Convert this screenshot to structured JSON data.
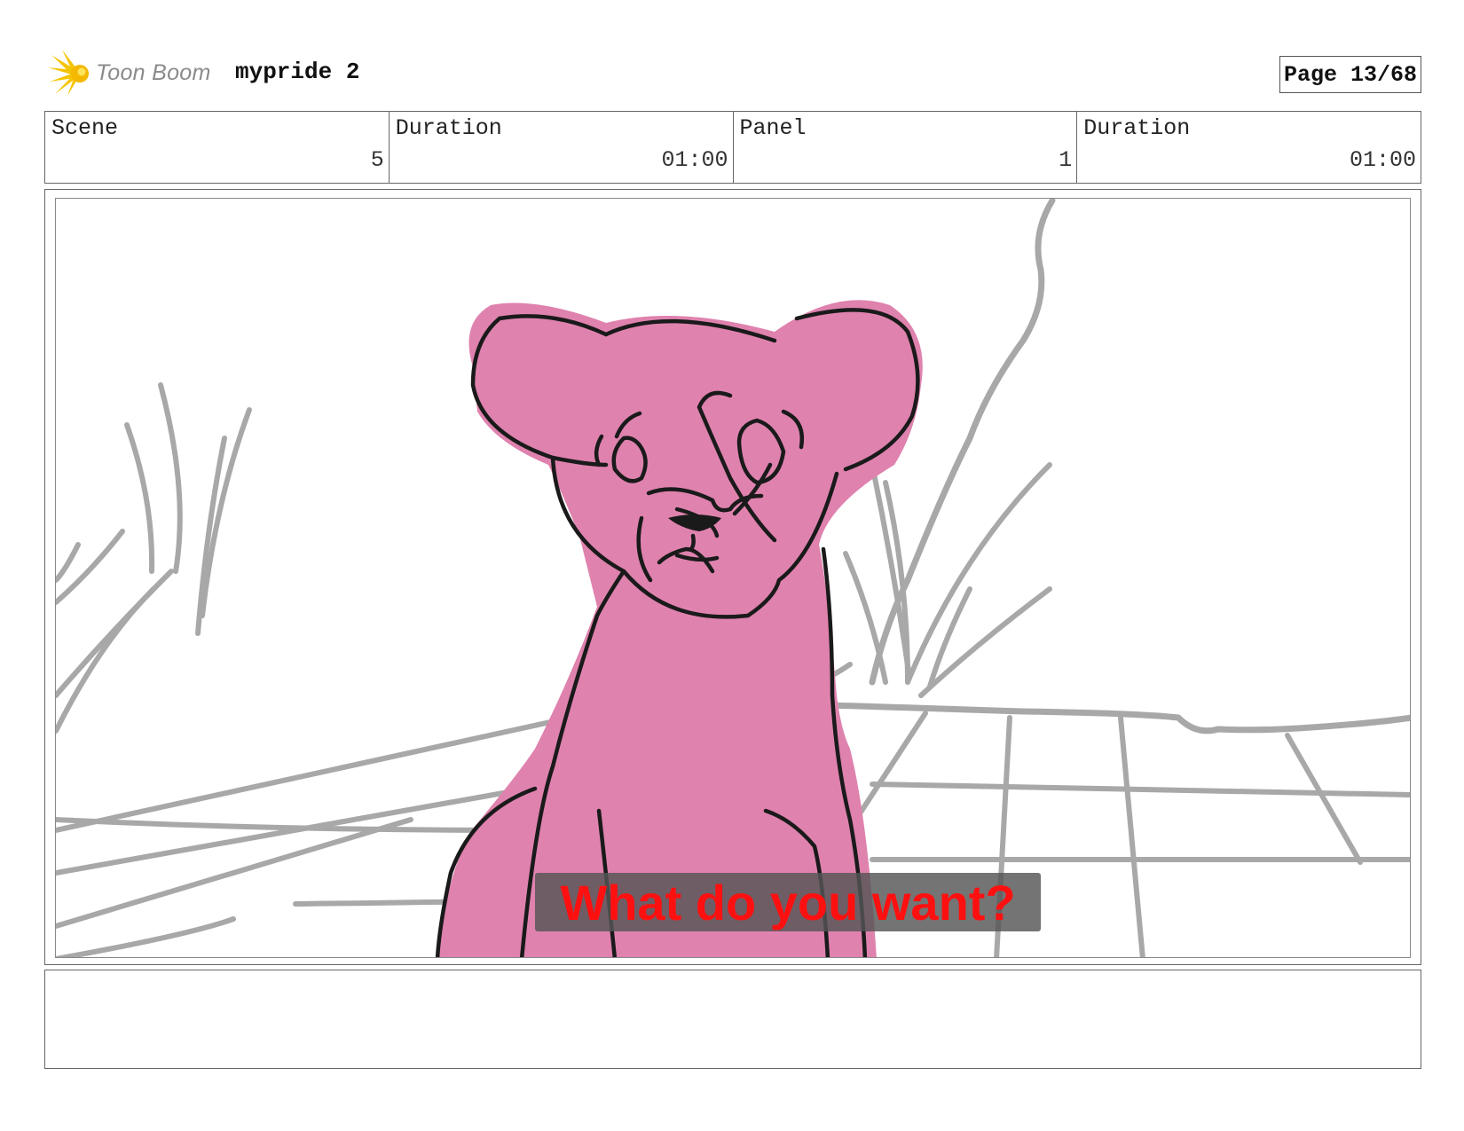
{
  "header": {
    "logo_text": "Toon Boom",
    "project_title": "mypride 2",
    "page_label": "Page 13/68"
  },
  "info": {
    "scene_label": "Scene",
    "scene_value": "5",
    "duration_label": "Duration",
    "duration_value": "01:00",
    "panel_label": "Panel",
    "panel_value": "1",
    "panel_duration_label": "Duration",
    "panel_duration_value": "01:00"
  },
  "panel": {
    "subtitle": "What do you want?",
    "subtitle_color": "#ff1010",
    "character_fill": "#df82ae"
  },
  "notes": {
    "text": ""
  }
}
